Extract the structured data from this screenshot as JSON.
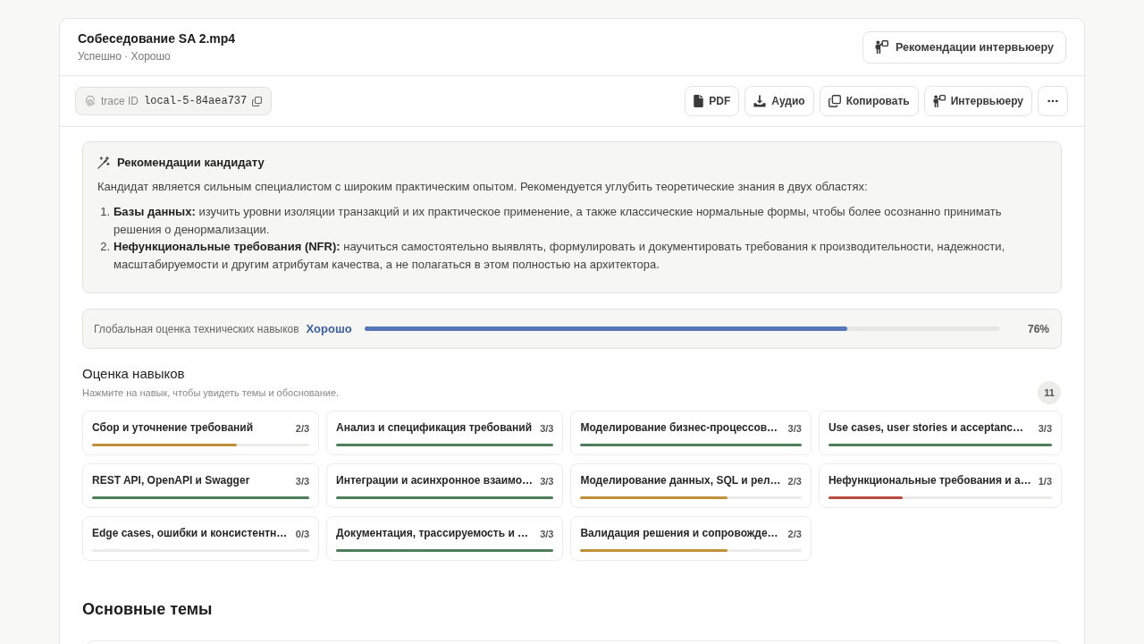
{
  "header": {
    "title": "Собеседование SA 2.mp4",
    "subtitle": "Успешно · Хорошо",
    "action_button": "Рекомендации интервьюеру"
  },
  "toolbar": {
    "trace_label": "trace ID",
    "trace_id": "local-5-84aea737",
    "buttons": [
      {
        "kind": "pdf",
        "label": "PDF"
      },
      {
        "kind": "download",
        "label": "Аудио"
      },
      {
        "kind": "copy",
        "label": "Копировать"
      },
      {
        "kind": "presenter",
        "label": "Интервьюеру"
      },
      {
        "kind": "more"
      }
    ]
  },
  "recommendations": {
    "title": "Рекомендации кандидату",
    "intro": "Кандидат является сильным специалистом с широким практическим опытом. Рекомендуется углубить теоретические знания в двух областях:",
    "items": [
      {
        "number": "1.",
        "text": "**Базы данных:** изучить уровни изоляции транзакций и их практическое применение, а также классические нормальные формы, чтобы более осознанно принимать решения о денормализации."
      },
      {
        "number": "2.",
        "text": "**Нефункциональные требования (NFR):** научиться самостоятельно выявлять, формулировать и документировать требования к производительности, надежности, масштабируемости и другим атрибутам качества, а не полагаться в этом полностью на архитектора."
      }
    ]
  },
  "global_score": {
    "label": "Глобальная оценка технических навыков",
    "rating": "Хорошо",
    "level": 0.76,
    "percent": "76%"
  },
  "skills": {
    "title": "Оценка навыков",
    "hint": "Нажмите на навык, чтобы увидеть темы и обоснование.",
    "count": "11",
    "items": [
      {
        "name": "Сбор и уточнение требований",
        "score": "2/3",
        "level": 0.667,
        "color": "#c0903a"
      },
      {
        "name": "Анализ и спецификация требований",
        "score": "3/3",
        "level": 1,
        "color": "#4f7f5a"
      },
      {
        "name": "Моделирование бизнес-процессов…",
        "score": "3/3",
        "level": 1,
        "color": "#4f7f5a"
      },
      {
        "name": "Use cases, user stories и acceptanc…",
        "score": "3/3",
        "level": 1,
        "color": "#4f7f5a"
      },
      {
        "name": "REST API, OpenAPI и Swagger",
        "score": "3/3",
        "level": 1,
        "color": "#4f7f5a"
      },
      {
        "name": "Интеграции и асинхронное взаимо…",
        "score": "3/3",
        "level": 1,
        "color": "#4f7f5a"
      },
      {
        "name": "Моделирование данных, SQL и рел…",
        "score": "2/3",
        "level": 0.667,
        "color": "#c0903a"
      },
      {
        "name": "Нефункциональные требования и а…",
        "score": "1/3",
        "level": 0.333,
        "color": "#b84b42"
      },
      {
        "name": "Edge cases, ошибки и консистентн…",
        "score": "0/3"
      },
      {
        "name": "Документация, трассируемость и …",
        "score": "3/3",
        "level": 1,
        "color": "#4f7f5a"
      },
      {
        "name": "Валидация решения и сопровожде…",
        "score": "2/3",
        "level": 0.667,
        "color": "#c0903a"
      }
    ]
  },
  "main_topics": {
    "title": "Основные темы"
  }
}
